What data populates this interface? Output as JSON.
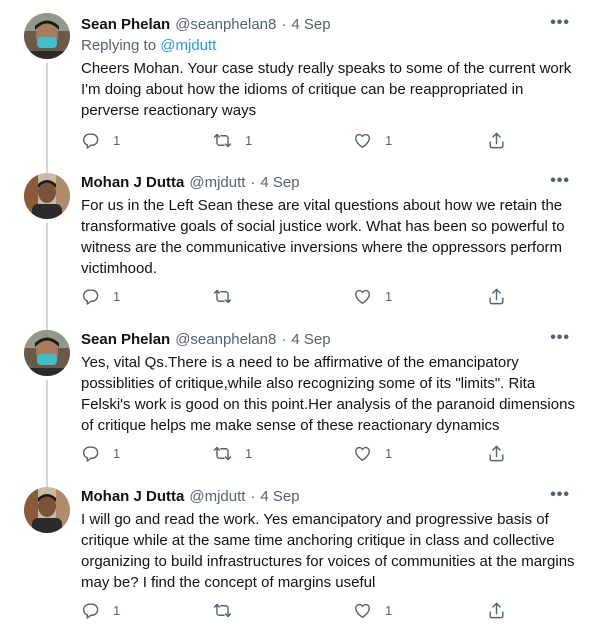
{
  "tweets": [
    {
      "name": "Sean Phelan",
      "handle": "@seanphelan8",
      "separator": "·",
      "date": "4 Sep",
      "more": "•••",
      "replying_prefix": "Replying to ",
      "replying_to": "@mjdutt",
      "text": "Cheers Mohan. Your case study really speaks to some of the current work I'm doing about how the idioms of critique can be reappropriated in perverse reactionary ways",
      "reply_count": "1",
      "retweet_count": "1",
      "like_count": "1"
    },
    {
      "name": "Mohan J Dutta",
      "handle": "@mjdutt",
      "separator": "·",
      "date": "4 Sep",
      "more": "•••",
      "text": "For us in the Left Sean these are vital questions about how we retain the transformative goals of social justice work. What has been so powerful to witness are the communicative inversions where the oppressors perform victimhood.",
      "reply_count": "1",
      "retweet_count": "",
      "like_count": "1"
    },
    {
      "name": "Sean Phelan",
      "handle": "@seanphelan8",
      "separator": "·",
      "date": "4 Sep",
      "more": "•••",
      "text": "Yes, vital Qs.There is a need to be affirmative of the emancipatory possiblities of critique,while also recognizing some of its \"limits\". Rita Felski's work is good on this point.Her analysis of the paranoid dimensions of critique helps me make sense of these reactionary dynamics",
      "reply_count": "1",
      "retweet_count": "1",
      "like_count": "1"
    },
    {
      "name": "Mohan J Dutta",
      "handle": "@mjdutt",
      "separator": "·",
      "date": "4 Sep",
      "more": "•••",
      "text": "I will go and read the work. Yes emancipatory and progressive basis of critique while at the same time anchoring critique in class and collective organizing to build infrastructures for voices of communities at the margins may be? I find the concept of margins useful",
      "reply_count": "1",
      "retweet_count": "",
      "like_count": "1"
    }
  ],
  "colors": {
    "text": "#0f1419",
    "secondary": "#536471",
    "link": "#1d9bf0",
    "thread_line": "#cfd9de"
  },
  "icons": {
    "reply": "reply-icon",
    "retweet": "retweet-icon",
    "like": "heart-icon",
    "share": "share-icon",
    "more": "more-icon"
  }
}
